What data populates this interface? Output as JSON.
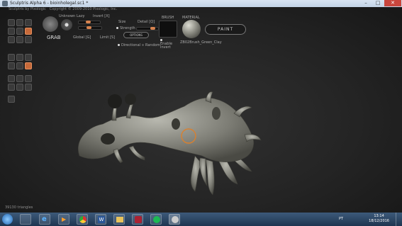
{
  "window": {
    "title": "Sculptris Alpha 6 - bioinholegal.sc1 *",
    "minimize": "–",
    "maximize": "□",
    "close": "✕"
  },
  "app_header": {
    "brand": "Sculptris by Pixologic",
    "copyright": "Copyright © 2009-2010 Pixologic, Inc."
  },
  "toolbar": {
    "tool_name": "GRAB",
    "unknown_label": "Unknown",
    "lazy_label": "Lazy",
    "invert_label": "Invert [X]",
    "size_label": "Size",
    "strength_label": "Strength",
    "detail_label": "Detail [Q]",
    "global_label": "Global [G]",
    "limit_label": "Limit [S]",
    "options_button": "OPTIONS",
    "directional_label": "Directional",
    "random_label": "Random",
    "brush_label": "BRUSH",
    "enable_invert_label": "Enable Invert",
    "material_label": "MATERIAL",
    "material_name": "ZB02Brush_Green_Clay",
    "paint_button": "PAINT"
  },
  "status": {
    "triangles": "39130 triangles"
  },
  "taskbar": {
    "language": "PT",
    "time": "13:14",
    "date": "18/12/2016",
    "icons": [
      "start-orb-icon",
      "explorer-icon",
      "ie-icon",
      "media-player-icon",
      "folder-icon",
      "chrome-icon",
      "word-icon",
      "explorer-folder-icon",
      "store-icon",
      "game-icon",
      "spotify-icon",
      "sculptris-icon"
    ]
  }
}
